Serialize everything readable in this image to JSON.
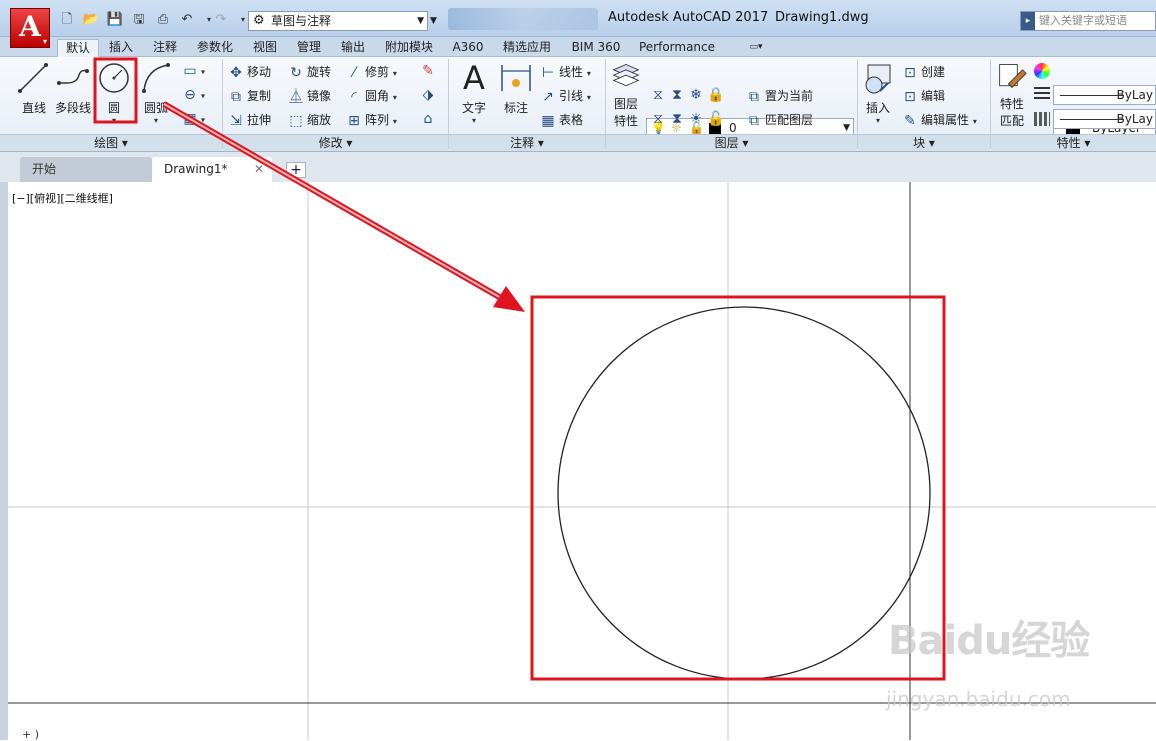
{
  "title_bar": {
    "app_title": "Autodesk AutoCAD 2017",
    "document_title": "Drawing1.dwg",
    "workspace": "草图与注释",
    "search_placeholder": "键入关键字或短语",
    "app_button": "A"
  },
  "ribbon_tabs": [
    "默认",
    "插入",
    "注释",
    "参数化",
    "视图",
    "管理",
    "输出",
    "附加模块",
    "A360",
    "精选应用",
    "BIM 360",
    "Performance"
  ],
  "panels": {
    "draw": {
      "title": "绘图",
      "line": "直线",
      "polyline": "多段线",
      "circle": "圆",
      "arc": "圆弧"
    },
    "modify": {
      "title": "修改",
      "move": "移动",
      "rotate": "旋转",
      "trim": "修剪",
      "copy": "复制",
      "mirror": "镜像",
      "fillet": "圆角",
      "stretch": "拉伸",
      "scale": "缩放",
      "array": "阵列"
    },
    "annotation": {
      "title": "注释",
      "text": "文字",
      "dimension": "标注",
      "linear": "线性",
      "leader": "引线",
      "table": "表格"
    },
    "layers": {
      "title": "图层",
      "layer_properties_line1": "图层",
      "layer_properties_line2": "特性",
      "current_layer": "0",
      "make_current": "置为当前",
      "match_layer": "匹配图层"
    },
    "block": {
      "title": "块",
      "insert": "插入",
      "create": "创建",
      "edit": "编辑",
      "edit_attributes": "编辑属性"
    },
    "properties": {
      "title": "特性",
      "match_line1": "特性",
      "match_line2": "匹配",
      "color": "ByLayer",
      "linetype": "ByLay",
      "lineweight": "ByLay"
    }
  },
  "doc_tabs": {
    "start": "开始",
    "drawing": "Drawing1*",
    "new": "+"
  },
  "viewport_label": "[−][俯视][二维线框]",
  "watermark": "Baidu经验",
  "watermark_url": "jingyan.baidu.com",
  "corner_text": "+ )",
  "colors": {
    "highlight": "#e0141e",
    "ribbon_bg": "#e6edf6",
    "title_bg": "#c4d8ee"
  }
}
